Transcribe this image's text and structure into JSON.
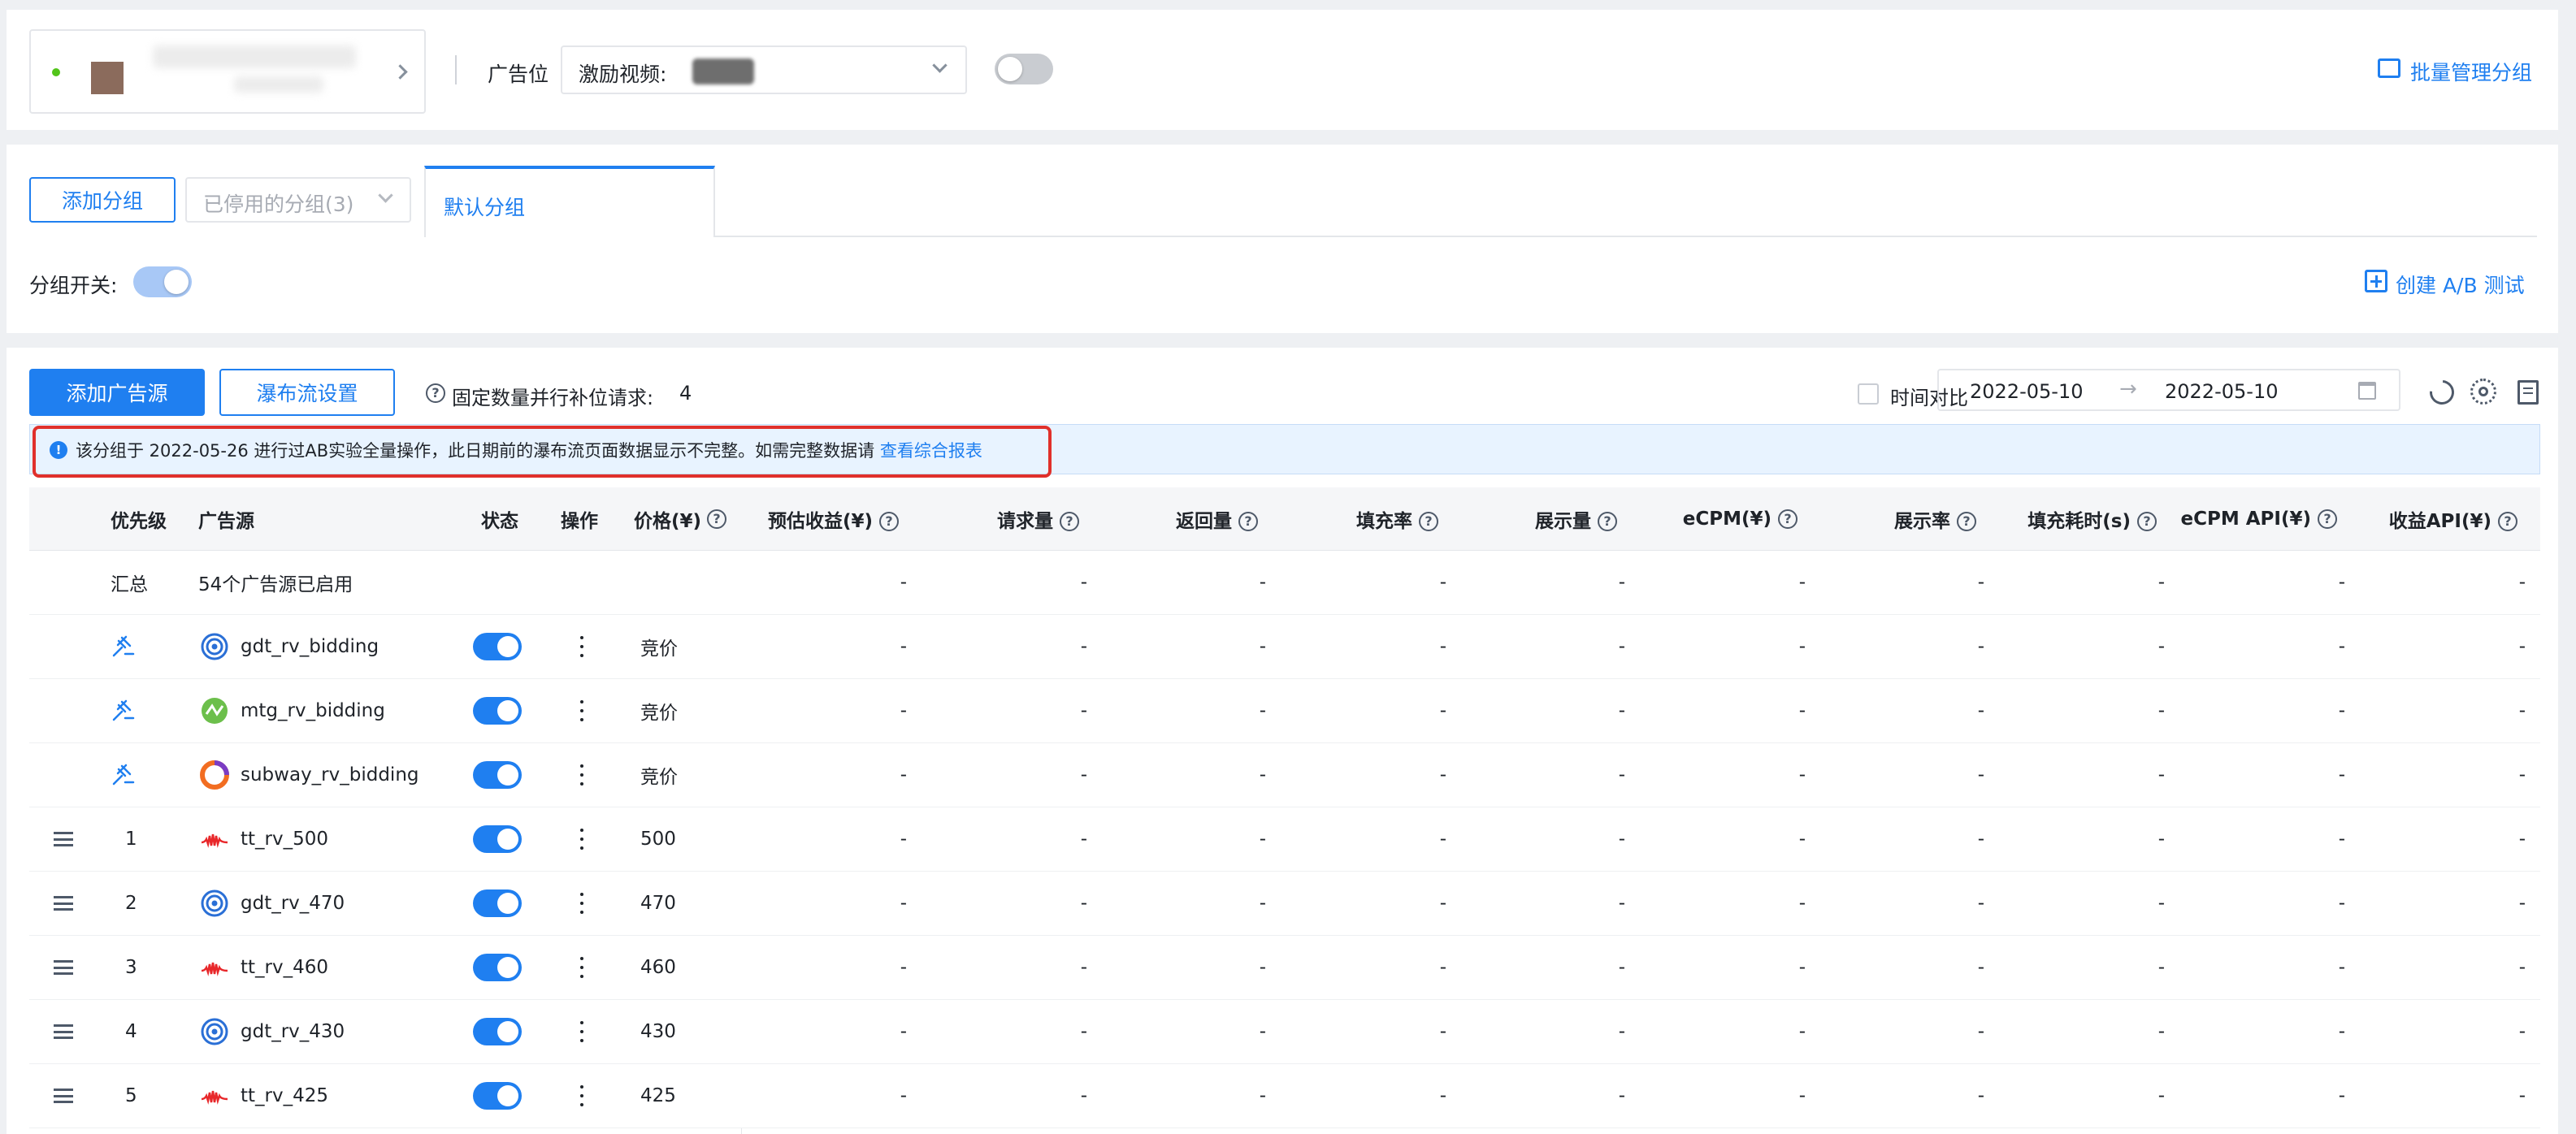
{
  "header": {
    "app_selector_label": "广告位",
    "ad_slot_prefix": "激励视频:",
    "batch_manage": "批量管理分组"
  },
  "groups": {
    "add_group": "添加分组",
    "disabled_groups": "已停用的分组(3)",
    "active_tab": "默认分组",
    "switch_label": "分组开关:",
    "create_ab": "创建 A/B 测试"
  },
  "toolbar": {
    "add_source": "添加广告源",
    "waterfall": "瀑布流设置",
    "parallel_label": "固定数量并行补位请求:",
    "parallel_value": "4",
    "compare_label": "时间对比",
    "date_start": "2022-05-10",
    "date_end": "2022-05-10"
  },
  "notice": {
    "text": "该分组于 2022-05-26 进行过AB实验全量操作，此日期前的瀑布流页面数据显示不完整。如需完整数据请",
    "link": "查看综合报表"
  },
  "table": {
    "headers": {
      "priority": "优先级",
      "source": "广告源",
      "status": "状态",
      "action": "操作",
      "price": "价格(¥)",
      "metrics": [
        "预估收益(¥)",
        "请求量",
        "返回量",
        "填充率",
        "展示量",
        "eCPM(¥)",
        "展示率",
        "填充耗时(s)",
        "eCPM API(¥)",
        "收益API(¥)"
      ]
    },
    "summary": {
      "label": "汇总",
      "text": "54个广告源已启用"
    },
    "placeholder": "-",
    "rows": [
      {
        "priority": "",
        "bidding": true,
        "icon": "gdt-icon",
        "name": "gdt_rv_bidding",
        "price": "竞价"
      },
      {
        "priority": "",
        "bidding": true,
        "icon": "mtg-icon",
        "name": "mtg_rv_bidding",
        "price": "竞价"
      },
      {
        "priority": "",
        "bidding": true,
        "icon": "subway-icon",
        "name": "subway_rv_bidding",
        "price": "竞价"
      },
      {
        "priority": "1",
        "bidding": false,
        "icon": "tt-icon",
        "name": "tt_rv_500",
        "price": "500"
      },
      {
        "priority": "2",
        "bidding": false,
        "icon": "gdt-icon",
        "name": "gdt_rv_470",
        "price": "470"
      },
      {
        "priority": "3",
        "bidding": false,
        "icon": "tt-icon",
        "name": "tt_rv_460",
        "price": "460"
      },
      {
        "priority": "4",
        "bidding": false,
        "icon": "gdt-icon",
        "name": "gdt_rv_430",
        "price": "430"
      },
      {
        "priority": "5",
        "bidding": false,
        "icon": "tt-icon",
        "name": "tt_rv_425",
        "price": "425"
      }
    ]
  }
}
